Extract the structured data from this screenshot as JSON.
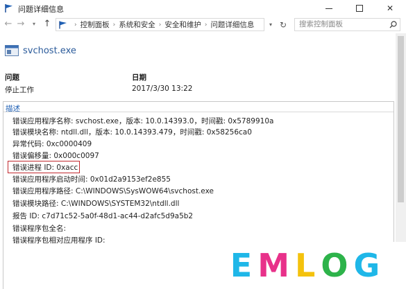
{
  "window": {
    "title": "问题详细信息",
    "minimize_icon": "minimize-icon",
    "maximize_icon": "maximize-icon",
    "close_glyph": "✕"
  },
  "nav": {
    "back": "←",
    "forward": "→",
    "recent": "▾",
    "up": "↑",
    "breadcrumb": [
      "控制面板",
      "系统和安全",
      "安全和维护",
      "问题详细信息"
    ],
    "separator": "›",
    "dropdown": "▾",
    "refresh": "↻",
    "search_placeholder": "搜索控制面板"
  },
  "header": {
    "app_name": "svchost.exe",
    "col1_label": "问题",
    "col2_label": "日期",
    "col1_value": "停止工作",
    "col2_value": "2017/3/30 13:22"
  },
  "description": {
    "label": "描述",
    "rows": [
      "错误应用程序名称: svchost.exe，版本: 10.0.14393.0，时间戳: 0x5789910a",
      "错误模块名称: ntdll.dll，版本: 10.0.14393.479，时间戳: 0x58256ca0",
      "异常代码: 0xc0000409",
      "错误偏移量: 0x000c0097",
      "错误进程 ID: 0xacc",
      "错误应用程序启动时间: 0x01d2a9153ef2e855",
      "错误应用程序路径: C:\\WINDOWS\\SysWOW64\\svchost.exe",
      "错误模块路径: C:\\WINDOWS\\SYSTEM32\\ntdll.dll",
      "报告 ID: c7d71c52-5a0f-48d1-ac44-d2afc5d9a5b2",
      "错误程序包全名:",
      "错误程序包相对应用程序 ID:"
    ]
  },
  "watermark": {
    "letters": [
      "E",
      "M",
      "L",
      "O",
      "G"
    ],
    "colors": [
      "#1fb7e8",
      "#e8318a",
      "#f4c20d",
      "#2db34a",
      "#1fb7e8"
    ]
  }
}
